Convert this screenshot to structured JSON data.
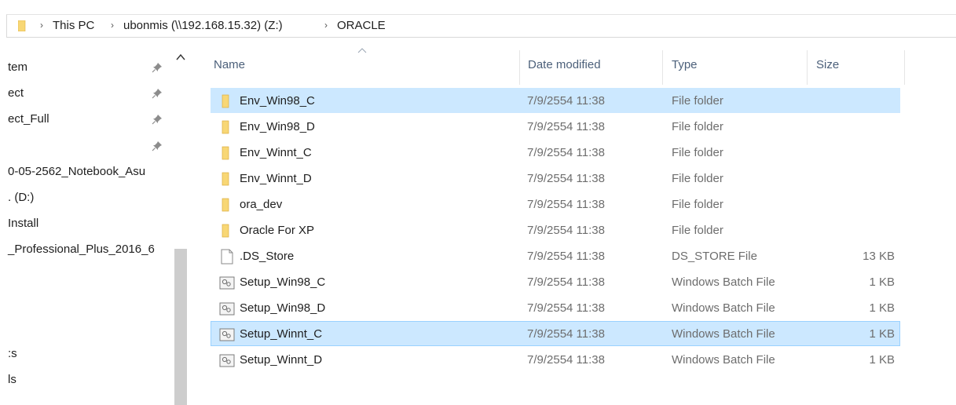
{
  "breadcrumb": {
    "items": [
      "This PC",
      "ubonmis (\\\\192.168.15.32) (Z:)",
      "ORACLE"
    ]
  },
  "nav": {
    "items": [
      {
        "label": "tem",
        "pinned": true
      },
      {
        "label": "ect",
        "pinned": true
      },
      {
        "label": "ect_Full",
        "pinned": true
      },
      {
        "label": "",
        "pinned": true
      },
      {
        "label": "0-05-2562_Notebook_Asu",
        "pinned": false
      },
      {
        "label": ". (D:)",
        "pinned": false
      },
      {
        "label": "Install",
        "pinned": false
      },
      {
        "label": "_Professional_Plus_2016_6",
        "pinned": false
      },
      {
        "label": "",
        "pinned": false
      },
      {
        "label": "",
        "pinned": false
      },
      {
        "label": "",
        "pinned": false
      },
      {
        "label": ":s",
        "pinned": false
      },
      {
        "label": "ls",
        "pinned": false
      }
    ]
  },
  "columns": {
    "name": "Name",
    "date": "Date modified",
    "type": "Type",
    "size": "Size"
  },
  "files": [
    {
      "name": "Env_Win98_C",
      "date": "7/9/2554 11:38",
      "type": "File folder",
      "size": "",
      "icon": "folder-icon",
      "state": "selected"
    },
    {
      "name": "Env_Win98_D",
      "date": "7/9/2554 11:38",
      "type": "File folder",
      "size": "",
      "icon": "folder-icon",
      "state": ""
    },
    {
      "name": "Env_Winnt_C",
      "date": "7/9/2554 11:38",
      "type": "File folder",
      "size": "",
      "icon": "folder-icon",
      "state": ""
    },
    {
      "name": "Env_Winnt_D",
      "date": "7/9/2554 11:38",
      "type": "File folder",
      "size": "",
      "icon": "folder-icon",
      "state": ""
    },
    {
      "name": "ora_dev",
      "date": "7/9/2554 11:38",
      "type": "File folder",
      "size": "",
      "icon": "folder-icon",
      "state": ""
    },
    {
      "name": "Oracle For XP",
      "date": "7/9/2554 11:38",
      "type": "File folder",
      "size": "",
      "icon": "folder-icon",
      "state": ""
    },
    {
      "name": ".DS_Store",
      "date": "7/9/2554 11:38",
      "type": "DS_STORE File",
      "size": "13 KB",
      "icon": "blank-file-icon",
      "state": ""
    },
    {
      "name": "Setup_Win98_C",
      "date": "7/9/2554 11:38",
      "type": "Windows Batch File",
      "size": "1 KB",
      "icon": "batch-file-icon",
      "state": ""
    },
    {
      "name": "Setup_Win98_D",
      "date": "7/9/2554 11:38",
      "type": "Windows Batch File",
      "size": "1 KB",
      "icon": "batch-file-icon",
      "state": ""
    },
    {
      "name": "Setup_Winnt_C",
      "date": "7/9/2554 11:38",
      "type": "Windows Batch File",
      "size": "1 KB",
      "icon": "batch-file-icon",
      "state": "focused"
    },
    {
      "name": "Setup_Winnt_D",
      "date": "7/9/2554 11:38",
      "type": "Windows Batch File",
      "size": "1 KB",
      "icon": "batch-file-icon",
      "state": ""
    }
  ],
  "colors": {
    "selection": "#cce8ff",
    "focus_border": "#99d1ff",
    "folder": "#f8d775"
  }
}
